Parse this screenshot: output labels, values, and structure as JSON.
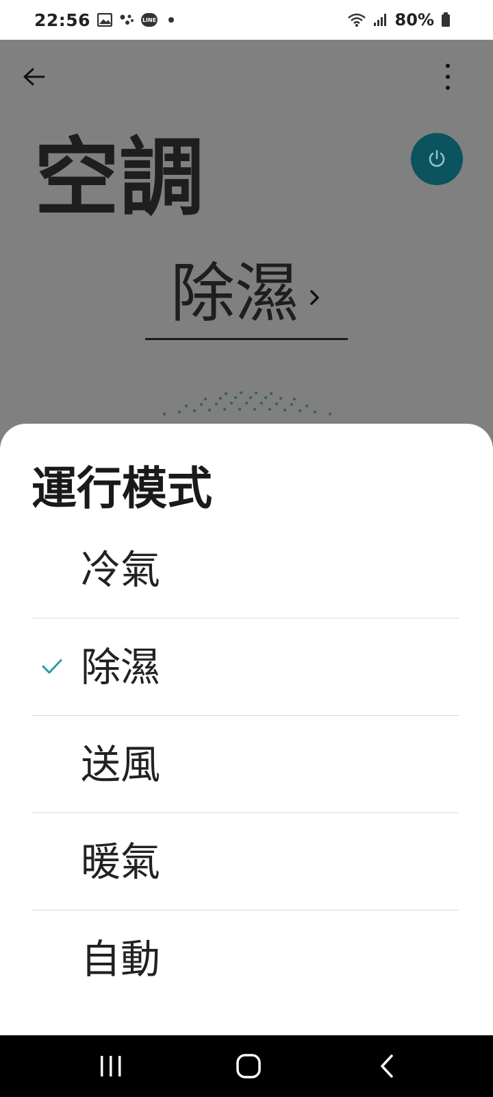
{
  "status_bar": {
    "time": "22:56",
    "line_label": "LINE",
    "battery_percent": "80%",
    "icons": [
      "image-icon",
      "assistant-dots-icon",
      "line-app-icon",
      "notification-dot-icon",
      "wifi-icon",
      "signal-icon",
      "battery-icon"
    ]
  },
  "device": {
    "title": "空調",
    "current_mode": "除濕",
    "accent_color": "#0c5360"
  },
  "sheet": {
    "title": "運行模式",
    "options": [
      {
        "label": "冷氣",
        "selected": false
      },
      {
        "label": "除濕",
        "selected": true
      },
      {
        "label": "送風",
        "selected": false
      },
      {
        "label": "暖氣",
        "selected": false
      },
      {
        "label": "自動",
        "selected": false
      }
    ],
    "check_color": "#2a9aa0"
  },
  "nav_bar": {
    "buttons": [
      "recent-apps-icon",
      "home-icon",
      "back-icon"
    ]
  }
}
